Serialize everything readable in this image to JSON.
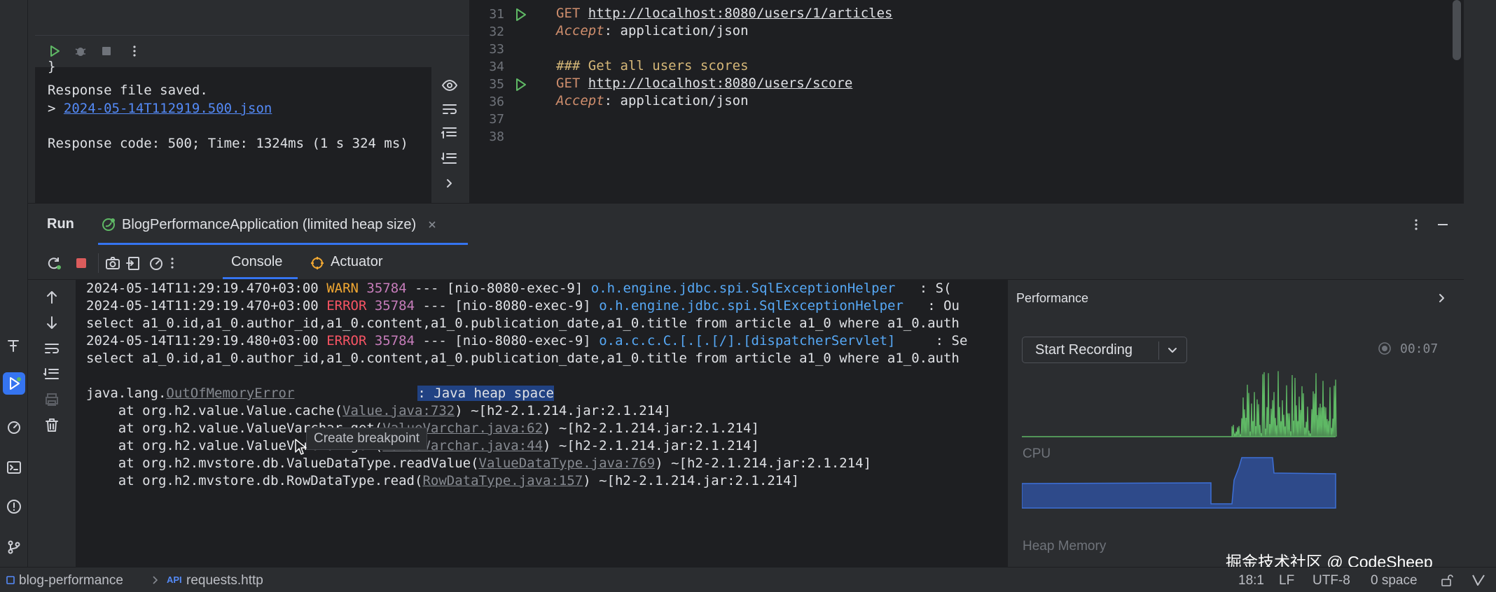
{
  "service_output": {
    "brace": "}",
    "saved": "Response file saved.",
    "prompt": ">",
    "file_link": "2024-05-14T112919.500.json",
    "response": "Response code: 500; Time: 1324ms (1 s 324 ms)"
  },
  "editor": {
    "lines": [
      {
        "num": "31",
        "method": "GET",
        "url": "http://localhost:8080/users/1/articles"
      },
      {
        "num": "32",
        "header": "Accept",
        "value": ": application/json"
      },
      {
        "num": "33"
      },
      {
        "num": "34",
        "comment": "### Get all users scores"
      },
      {
        "num": "35",
        "method": "GET",
        "url": "http://localhost:8080/users/score"
      },
      {
        "num": "36",
        "header": "Accept",
        "value": ": application/json"
      },
      {
        "num": "37"
      },
      {
        "num": "38"
      }
    ]
  },
  "run_panel": {
    "title": "Run",
    "config_tab": "BlogPerformanceApplication (limited heap size)",
    "tabs": [
      "Console",
      "Actuator"
    ]
  },
  "console": {
    "logs": [
      {
        "ts": "2024-05-14T11:29:19.470+03:00",
        "level": " WARN",
        "pid": "35784",
        "sep": "---",
        "thread": "[nio-8080-exec-9]",
        "logger": "o.h.engine.jdbc.spi.SqlExceptionHelper",
        "tail": "  : S("
      },
      {
        "ts": "2024-05-14T11:29:19.470+03:00",
        "level": "ERROR",
        "pid": "35784",
        "sep": "---",
        "thread": "[nio-8080-exec-9]",
        "logger": "o.h.engine.jdbc.spi.SqlExceptionHelper",
        "tail": "  : Ou"
      },
      {
        "text": "select a1_0.id,a1_0.author_id,a1_0.content,a1_0.publication_date,a1_0.title from article a1_0 where a1_0.auth"
      },
      {
        "ts": "2024-05-14T11:29:19.480+03:00",
        "level": "ERROR",
        "pid": "35784",
        "sep": "---",
        "thread": "[nio-8080-exec-9]",
        "logger": "o.a.c.c.C.[.[.[/].[dispatcherServlet]",
        "tail": "    : Se"
      },
      {
        "text": "select a1_0.id,a1_0.author_id,a1_0.content,a1_0.publication_date,a1_0.title from article a1_0 where a1_0.auth"
      }
    ],
    "exception_prefix": "java.lang.",
    "exception_class": "OutOfMemoryError",
    "exception_message": ": Java heap space",
    "tooltip": "Create breakpoint",
    "stack": [
      {
        "pre": "    at org.h2.value.Value.cache(",
        "link": "Value.java:732",
        "post": ") ~[h2-2.1.214.jar:2.1.214]"
      },
      {
        "pre": "    at org.h2.value.ValueVarchar.get(",
        "link": "ValueVarchar.java:62",
        "post": ") ~[h2-2.1.214.jar:2.1.214]"
      },
      {
        "pre": "    at org.h2.value.ValueVarchar.get(",
        "link": "ValueVarchar.java:44",
        "post": ") ~[h2-2.1.214.jar:2.1.214]"
      },
      {
        "pre": "    at org.h2.mvstore.db.ValueDataType.readValue(",
        "link": "ValueDataType.java:769",
        "post": ") ~[h2-2.1.214.jar:2.1.214]"
      },
      {
        "pre": "    at org.h2.mvstore.db.RowDataType.read(",
        "link": "RowDataType.java:157",
        "post": ") ~[h2-2.1.214.jar:2.1.214]"
      }
    ]
  },
  "performance": {
    "title": "Performance",
    "record_label": "Start Recording",
    "timer": "00:07",
    "cpu_label": "CPU",
    "heap_label": "Heap Memory",
    "watermark": "掘金技术社区 @ CodeSheep",
    "colors": {
      "cpu": "#5fb865",
      "heap_fill": "#2e4a8a",
      "heap_line": "#3d6fd6"
    }
  },
  "status_bar": {
    "project": "blog-performance",
    "file_prefix": "API",
    "file": "requests.http",
    "position": "18:1",
    "line_sep": "LF",
    "encoding": "UTF-8",
    "indent": "0 space"
  },
  "colors": {
    "accent": "#3574f0",
    "run_green": "#5fb865",
    "stop_red": "#db5c5c"
  }
}
